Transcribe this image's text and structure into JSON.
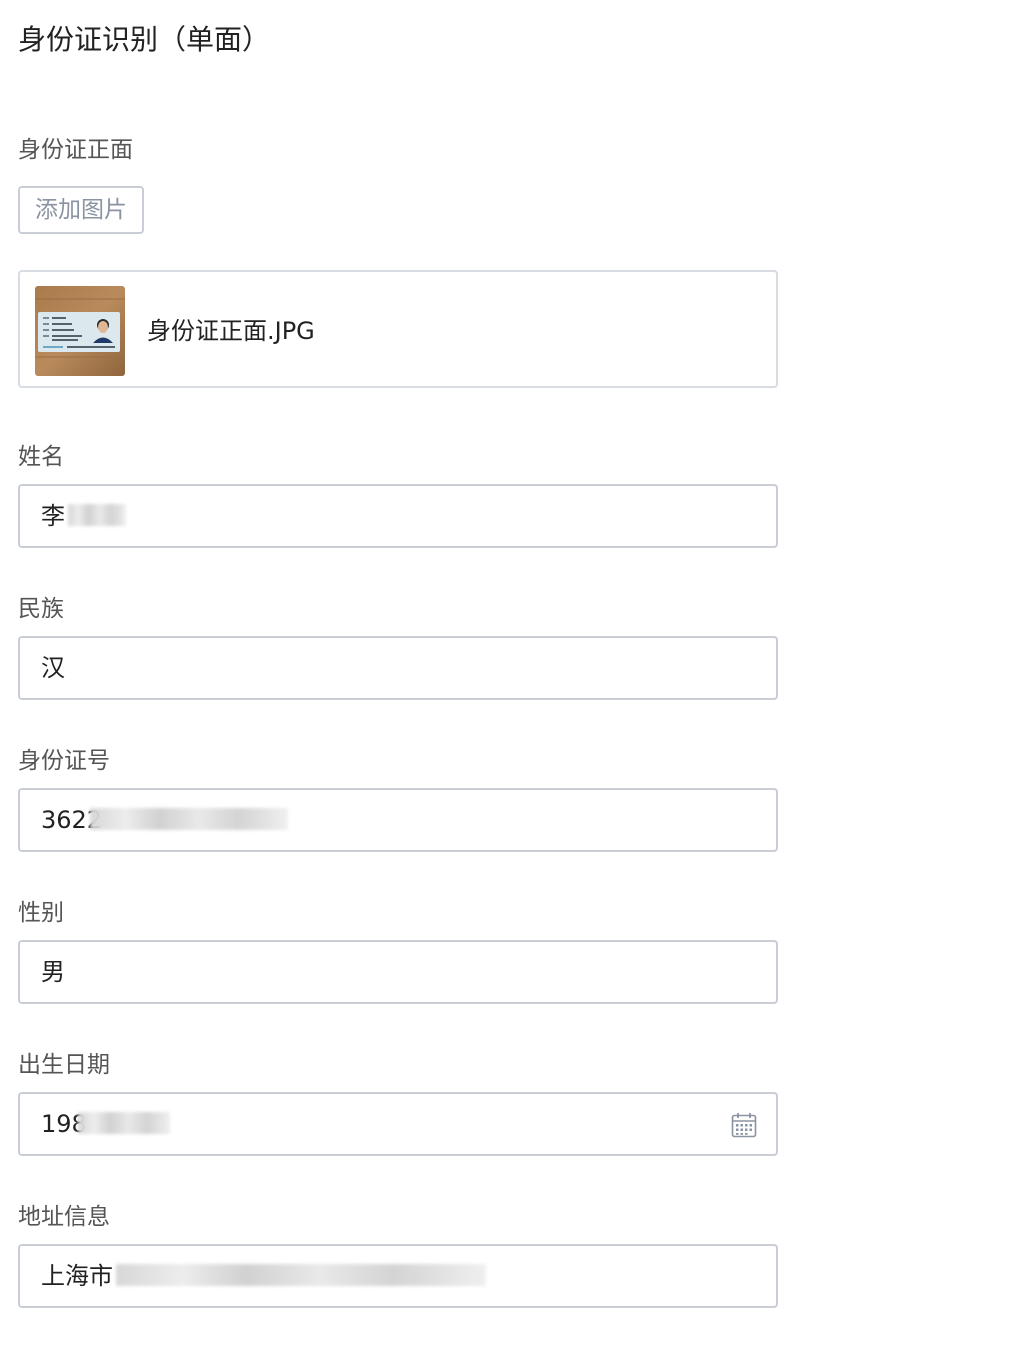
{
  "page_title": "身份证识别（单面）",
  "front_section": {
    "label": "身份证正面",
    "add_button_label": "添加图片",
    "file_name": "身份证正面.JPG"
  },
  "fields": {
    "name": {
      "label": "姓名",
      "value": "李"
    },
    "ethnicity": {
      "label": "民族",
      "value": "汉"
    },
    "id_number": {
      "label": "身份证号",
      "value": "3622"
    },
    "gender": {
      "label": "性别",
      "value": "男"
    },
    "birth_date": {
      "label": "出生日期",
      "value": "198"
    },
    "address": {
      "label": "地址信息",
      "value": "上海市"
    }
  },
  "icons": {
    "calendar": "calendar-icon"
  },
  "colors": {
    "border": "#c9ced6",
    "label": "#555555",
    "button_text": "#8a93a3",
    "redaction": "#d6d6d6"
  }
}
